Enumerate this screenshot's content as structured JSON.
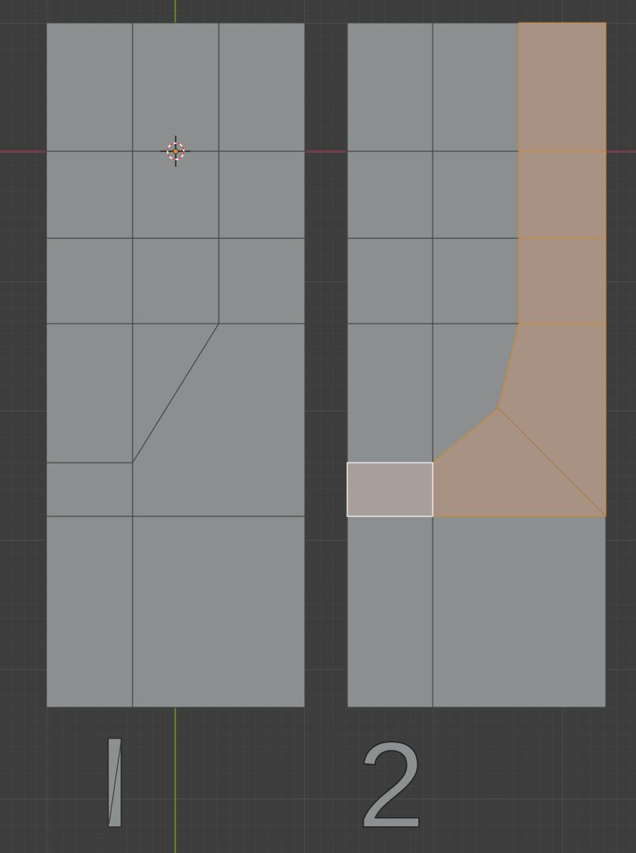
{
  "viewport": {
    "background": "#3d3d3d",
    "grid_minor_color": "#474747",
    "grid_major_color": "#525252",
    "axis_x_color": "#9a3548",
    "axis_y_color": "#6b9a1f"
  },
  "objects": {
    "mesh_1": {
      "face_color": "#8b8f8f",
      "edge_color": "#3a3a3a"
    },
    "mesh_2": {
      "face_color": "#8b8f8f",
      "selected_face_color": "#a89283",
      "selected_edge_color": "#d08a2a",
      "active_face_color": "#a89e9a",
      "active_edge_color": "#e6e6e6"
    },
    "cursor": {
      "name": "3d-cursor",
      "ring_colors": [
        "#e03a3a",
        "#ffffff"
      ],
      "center_color": "#e58a1f"
    }
  },
  "labels": {
    "one": "1",
    "two": "2"
  }
}
